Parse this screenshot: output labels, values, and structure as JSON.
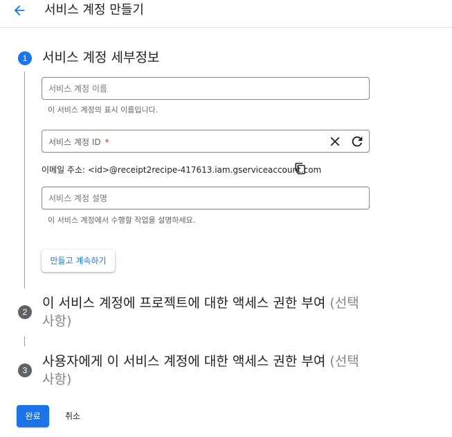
{
  "header": {
    "title": "서비스 계정 만들기",
    "back_icon": "arrow-back-icon"
  },
  "steps": [
    {
      "number": "1",
      "title": "서비스 계정 세부정보",
      "state": "active"
    },
    {
      "number": "2",
      "title": "이 서비스 계정에 프로젝트에 대한 액세스 권한 부여",
      "optional": "(선택사항)",
      "state": "inactive"
    },
    {
      "number": "3",
      "title": "사용자에게 이 서비스 계정에 대한 액세스 권한 부여",
      "optional": "(선택사항)",
      "state": "inactive"
    }
  ],
  "form": {
    "name": {
      "placeholder": "서비스 계정 이름",
      "value": "",
      "hint": "이 서비스 계정의 표시 이름입니다."
    },
    "id": {
      "placeholder": "서비스 계정 ID",
      "required_mark": "*",
      "value": "",
      "clear_icon": "close-icon",
      "refresh_icon": "refresh-icon"
    },
    "email": {
      "text": "이메일 주소: <id>@receipt2recipe-417613.iam.gserviceaccount.com",
      "copy_icon": "copy-icon"
    },
    "description": {
      "placeholder": "서비스 계정 설명",
      "value": "",
      "hint": "이 서비스 계정에서 수행할 작업을 설명하세요."
    },
    "continue_label": "만들고 계속하기"
  },
  "footer": {
    "done_label": "완료",
    "cancel_label": "취소"
  },
  "colors": {
    "primary": "#1a73e8",
    "required": "#d93025",
    "inactive_badge": "#5f6368",
    "muted": "#80868b"
  }
}
